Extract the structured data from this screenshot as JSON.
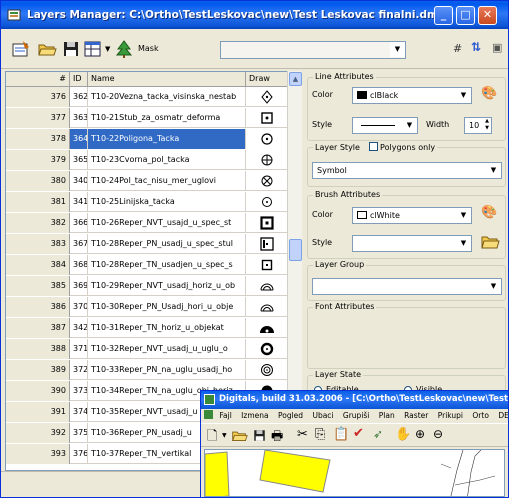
{
  "window": {
    "title": "Layers Manager: C:\\Ortho\\TestLeskovac\\new\\Test Leskovac finalni.dmf"
  },
  "toolbar": {
    "mask_label": "Mask",
    "mask_value": ""
  },
  "grid": {
    "headers": {
      "num": "#",
      "id": "ID",
      "name": "Name",
      "draw": "Draw"
    },
    "rows": [
      {
        "num": "376",
        "id": "362",
        "name": "T10-20Vezna_tacka_visinska_nestab",
        "symbol": "diamond-dot"
      },
      {
        "num": "377",
        "id": "363",
        "name": "T10-21Stub_za_osmatr_deforma",
        "symbol": "square-dot"
      },
      {
        "num": "378",
        "id": "364",
        "name": "T10-22Poligona_Tacka",
        "symbol": "circle-dot",
        "selected": true
      },
      {
        "num": "379",
        "id": "365",
        "name": "T10-23Cvorna_pol_tacka",
        "symbol": "circle-plus"
      },
      {
        "num": "380",
        "id": "340",
        "name": "T10-24Pol_tac_nisu_mer_uglovi",
        "symbol": "circle-x"
      },
      {
        "num": "381",
        "id": "341",
        "name": "T10-25Linijska_tacka",
        "symbol": "circle-small"
      },
      {
        "num": "382",
        "id": "366",
        "name": "T10-26Reper_NVT_usajd_u_spec_st",
        "symbol": "square-bold"
      },
      {
        "num": "383",
        "id": "367",
        "name": "T10-28Reper_PN_usadj_u_spec_stul",
        "symbol": "square-bars"
      },
      {
        "num": "384",
        "id": "368",
        "name": "T10-28Reper_TN_usadjen_u_spec_s",
        "symbol": "square-small"
      },
      {
        "num": "385",
        "id": "369",
        "name": "T10-29Reper_NVT_usadj_horiz_u_ob",
        "symbol": "arch"
      },
      {
        "num": "386",
        "id": "370",
        "name": "T10-30Reper_PN_Usadj_hori_u_obje",
        "symbol": "arch"
      },
      {
        "num": "387",
        "id": "342",
        "name": "T10-31Reper_TN_horiz_u_objekat",
        "symbol": "half-disc"
      },
      {
        "num": "388",
        "id": "371",
        "name": "T10-32Reper_NVT_usadj_u_uglu_o",
        "symbol": "ring-bold"
      },
      {
        "num": "389",
        "id": "372",
        "name": "T10-33Reper_PN_na_uglu_usadj_ho",
        "symbol": "ring-double"
      },
      {
        "num": "390",
        "id": "373",
        "name": "T10-34Reper_TN_na_uglu_obj_horiz",
        "symbol": "disc"
      },
      {
        "num": "391",
        "id": "374",
        "name": "T10-35Reper_NVT_usadj_u",
        "symbol": "none"
      },
      {
        "num": "392",
        "id": "375",
        "name": "T10-36Reper_PN_usadj_u",
        "symbol": "none"
      },
      {
        "num": "393",
        "id": "376",
        "name": "T10-37Reper_TN_vertikal",
        "symbol": "none"
      }
    ]
  },
  "line_attributes": {
    "legend": "Line Attributes",
    "color_label": "Color",
    "color_value": "clBlack",
    "color_hex": "#000000",
    "style_label": "Style",
    "width_label": "Width",
    "width_value": "10"
  },
  "layer_style": {
    "legend": "Layer Style",
    "polygons_only_label": "Polygons only",
    "value": "Symbol"
  },
  "brush_attributes": {
    "legend": "Brush Attributes",
    "color_label": "Color",
    "color_value": "clWhite",
    "color_hex": "#ffffff",
    "style_label": "Style",
    "style_value": ""
  },
  "layer_group": {
    "legend": "Layer Group",
    "value": ""
  },
  "font_attributes": {
    "legend": "Font Attributes"
  },
  "layer_state": {
    "legend": "Layer State",
    "editable_label": "Editable",
    "visible_label": "Visible"
  },
  "digitals": {
    "title": "Digitals, build 31.03.2006 - [C:\\Ortho\\TestLeskovac\\new\\Test L",
    "menu": [
      "Fajl",
      "Izmena",
      "Pogled",
      "Ubaci",
      "Grupiši",
      "Plan",
      "Raster",
      "Prikupi",
      "Orto",
      "DEM"
    ]
  }
}
